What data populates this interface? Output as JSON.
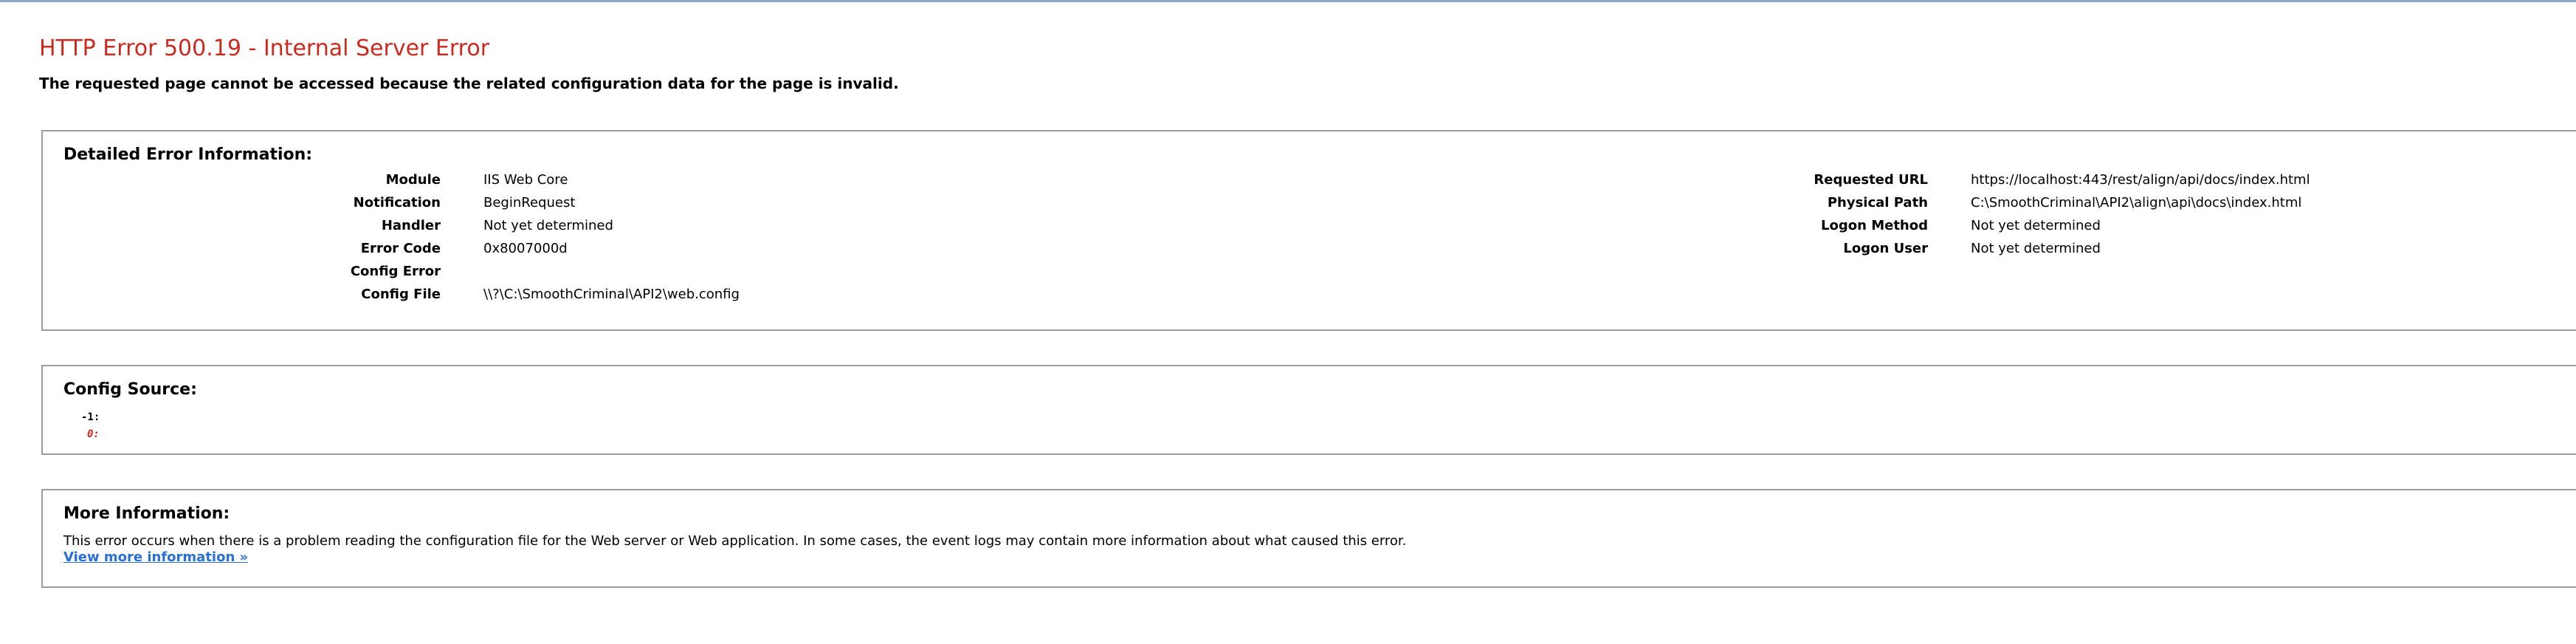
{
  "header": {
    "title": "HTTP Error 500.19 - Internal Server Error",
    "subtitle": "The requested page cannot be accessed because the related configuration data for the page is invalid."
  },
  "detailed_error": {
    "heading": "Detailed Error Information:",
    "left": [
      {
        "key": "Module",
        "value": "IIS Web Core"
      },
      {
        "key": "Notification",
        "value": "BeginRequest"
      },
      {
        "key": "Handler",
        "value": "Not yet determined"
      },
      {
        "key": "Error Code",
        "value": "0x8007000d"
      },
      {
        "key": "Config Error",
        "value": ""
      },
      {
        "key": "Config File",
        "value": "\\\\?\\C:\\SmoothCriminal\\API2\\web.config"
      }
    ],
    "right": [
      {
        "key": "Requested URL",
        "value": "https://localhost:443/rest/align/api/docs/index.html"
      },
      {
        "key": "Physical Path",
        "value": "C:\\SmoothCriminal\\API2\\align\\api\\docs\\index.html"
      },
      {
        "key": "Logon Method",
        "value": "Not yet determined"
      },
      {
        "key": "Logon User",
        "value": "Not yet determined"
      }
    ]
  },
  "config_source": {
    "heading": "Config Source:",
    "lines": [
      "-1:",
      "0:"
    ]
  },
  "more_info": {
    "heading": "More Information:",
    "text": "This error occurs when there is a problem reading the configuration file for the Web server or Web application. In some cases, the event logs may contain more information about what caused this error.",
    "link": "View more information »"
  },
  "colors": {
    "title_red": "#cc2a1e",
    "link_blue": "#2a6fd3",
    "border_gray": "#9c9c9c"
  }
}
